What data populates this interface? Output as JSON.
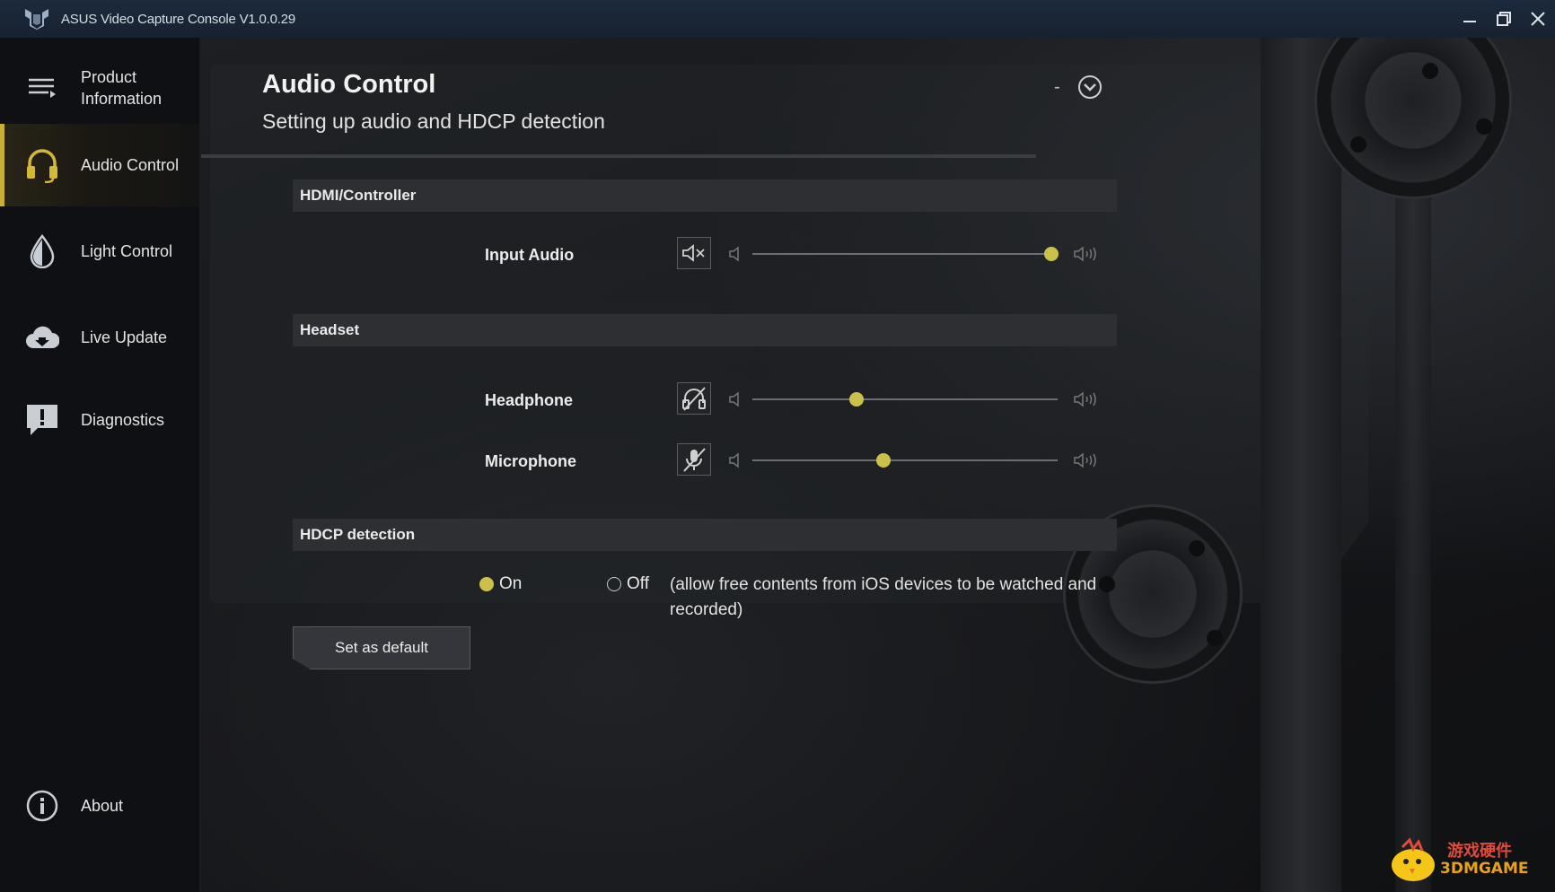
{
  "window": {
    "title": "ASUS Video Capture Console V1.0.0.29",
    "controls": [
      "minimize-icon",
      "maximize-icon",
      "close-icon"
    ]
  },
  "sidebar": {
    "items": [
      {
        "label_line1": "Product",
        "label_line2": "Information",
        "icon": "menu-list-icon"
      },
      {
        "label": "Audio Control",
        "icon": "headset-icon",
        "active": true
      },
      {
        "label": "Light Control",
        "icon": "light-drop-icon"
      },
      {
        "label": "Live Update",
        "icon": "cloud-download-icon"
      },
      {
        "label": "Diagnostics",
        "icon": "alert-chat-icon"
      }
    ],
    "about": {
      "label": "About",
      "icon": "info-circle-icon"
    }
  },
  "main": {
    "title": "Audio Control",
    "subtitle": "Setting up audio and HDCP detection",
    "collapse_dash": "-",
    "sections": {
      "hdmi": {
        "header": "HDMI/Controller",
        "rows": [
          {
            "label": "Input Audio",
            "icon": "speaker-mute-icon",
            "volume_fraction": 0.98
          }
        ]
      },
      "headset": {
        "header": "Headset",
        "rows": [
          {
            "label": "Headphone",
            "icon": "headphone-muted-icon",
            "volume_fraction": 0.34
          },
          {
            "label": "Microphone",
            "icon": "microphone-muted-icon",
            "volume_fraction": 0.43
          }
        ]
      },
      "hdcp": {
        "header": "HDCP detection",
        "option_on": "On",
        "option_off": "Off",
        "selected": "On",
        "note": "(allow free contents from iOS devices to be watched and recorded)"
      }
    },
    "default_button": "Set as default"
  },
  "watermark": {
    "cn": "游戏硬件",
    "en": "3DMGAME"
  },
  "colors": {
    "accent": "#cbc14a",
    "sidebar_active_bar": "#c9b035",
    "titlebar": "#1c2a3d"
  }
}
